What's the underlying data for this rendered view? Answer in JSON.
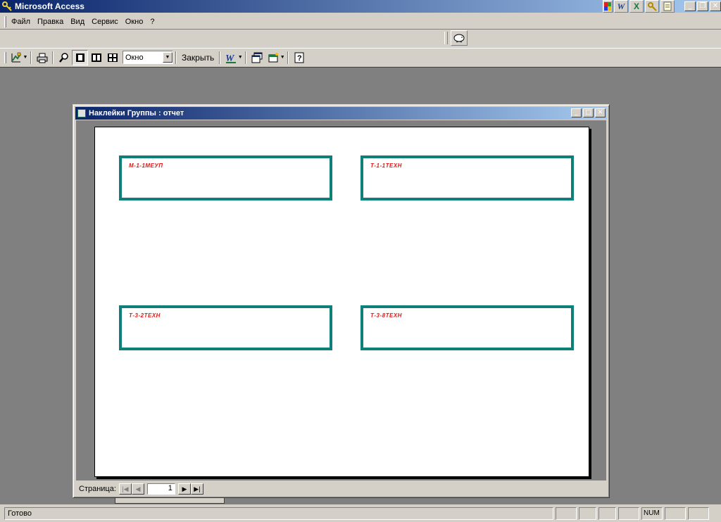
{
  "app": {
    "title": "Microsoft Access"
  },
  "menu": {
    "items": [
      {
        "label": "Файл"
      },
      {
        "label": "Правка"
      },
      {
        "label": "Вид"
      },
      {
        "label": "Сервис"
      },
      {
        "label": "Окно"
      },
      {
        "label": "?"
      }
    ]
  },
  "toolbar": {
    "zoom_value": "Окно",
    "close_label": "Закрыть"
  },
  "report_window": {
    "title": "Наклейки Группы : отчет",
    "labels": [
      {
        "text": "М-1-1МЕУП"
      },
      {
        "text": "Т-1-1ТЕХН"
      },
      {
        "text": "Т-3-2ТЕХН"
      },
      {
        "text": "Т-3-8ТЕХН"
      }
    ],
    "nav": {
      "page_label": "Страница:",
      "page_number": "1"
    }
  },
  "status": {
    "text": "Готово",
    "num": "NUM"
  },
  "colors": {
    "label_border": "#0f7f7a",
    "label_text": "#e01818",
    "titlebar_start": "#0a246a",
    "titlebar_end": "#a6caf0"
  }
}
